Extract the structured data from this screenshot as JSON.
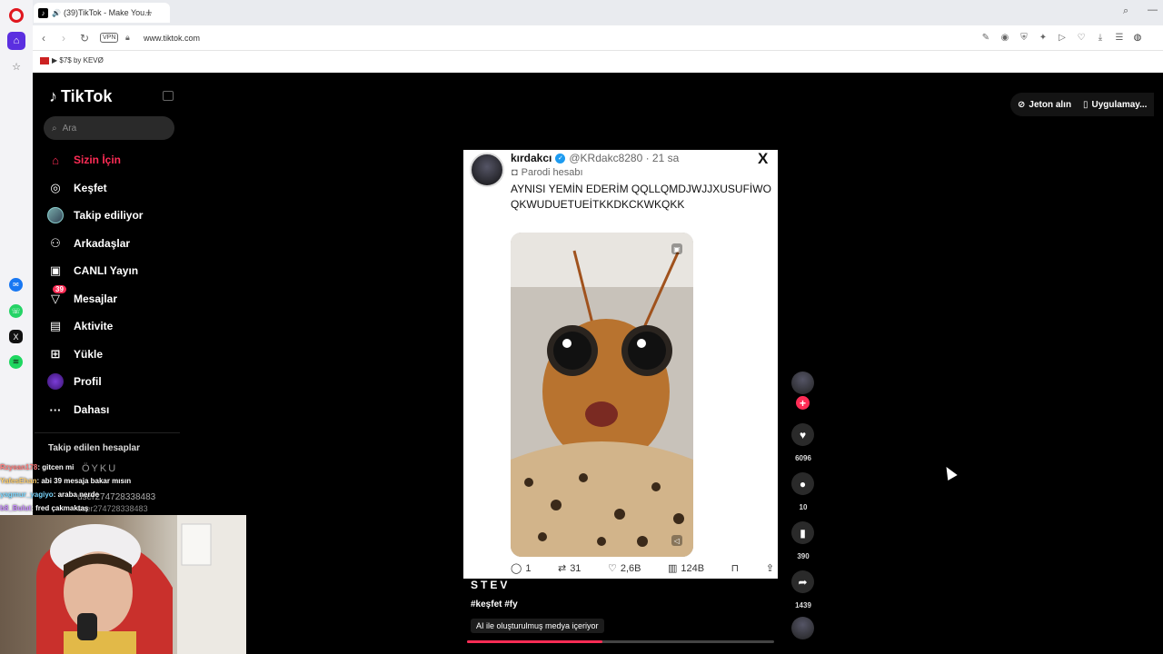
{
  "browser": {
    "tab_title": "(39)TikTok - Make You...",
    "url": "www.tiktok.com",
    "vpn_label": "VPN",
    "bookmark": "▶ $7$ by KEVØ"
  },
  "tiktok": {
    "logo_text": "TikTok",
    "search_placeholder": "Ara",
    "nav": [
      {
        "label": "Sizin İçin"
      },
      {
        "label": "Keşfet"
      },
      {
        "label": "Takip ediliyor"
      },
      {
        "label": "Arkadaşlar"
      },
      {
        "label": "CANLI Yayın"
      },
      {
        "label": "Mesajlar",
        "badge": "39"
      },
      {
        "label": "Aktivite"
      },
      {
        "label": "Yükle"
      },
      {
        "label": "Profil"
      },
      {
        "label": "Dahası"
      }
    ],
    "followed_title": "Takip edilen hesaplar",
    "followed_partial": [
      "ÖYKU",
      "user274728338483",
      "user274728338483"
    ],
    "top_buttons": {
      "coins": "Jeton alın",
      "app": "Uygulamay..."
    }
  },
  "tweet": {
    "name": "kırdakcı",
    "handle": "@KRdakc8280 · 21 sa",
    "parody": "Parodi hesabı",
    "text": "AYNISI YEMİN EDERİM QQLLQMDJWJJXUSUFİWOQKWUDUETUEİTKKDKCKWKQKK",
    "replies": "1",
    "retweets": "31",
    "likes": "2,6B",
    "views": "124B"
  },
  "video": {
    "username": "STEV",
    "tags": "#keşfet #fy",
    "ai_label": "AI ile oluşturulmuş medya içeriyor",
    "progress": 0.44
  },
  "rail": {
    "likes": "6096",
    "comments": "10",
    "saves": "390",
    "shares": "1439"
  },
  "stream_chat": [
    {
      "user": "Rzyean178",
      "msg": ": gitcen mi",
      "color": "#ff7a7a"
    },
    {
      "user": "YafesEhan",
      "msg": ": abi 39 mesaja bakar mısın",
      "color": "#ffcf6b"
    },
    {
      "user": "yagmur_yagiyo",
      "msg": ": araba nerde",
      "color": "#7ad7ff"
    },
    {
      "user": "b8_Bulut",
      "msg": ": fred çakmaktaş",
      "color": "#c88bff"
    }
  ]
}
